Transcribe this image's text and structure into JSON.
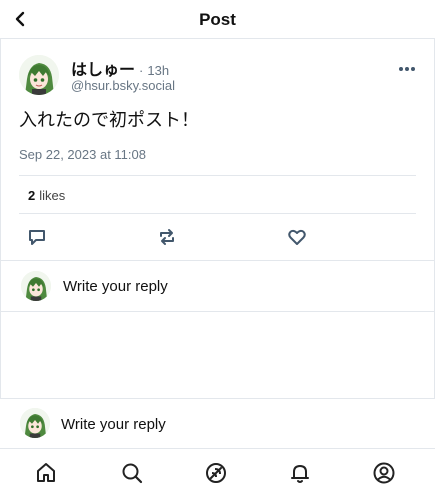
{
  "header": {
    "back_icon": "chevron-left-icon",
    "title": "Post"
  },
  "post": {
    "display_name": "はしゅー",
    "separator": "·",
    "time": "13h",
    "handle": "@hsur.bsky.social",
    "text": "入れたので初ポスト！",
    "date": "Sep 22, 2023 at 11:08",
    "likes_count": "2",
    "likes_label": "likes",
    "actions": [
      "reply-icon",
      "repost-icon",
      "like-heart-icon"
    ],
    "more_icon": "more-dots-icon"
  },
  "reply": {
    "placeholder": "Write your reply"
  },
  "bottom_reply": {
    "placeholder": "Write your reply"
  },
  "tabbar": {
    "items": [
      "home-icon",
      "search-icon",
      "feeds-icon",
      "notifications-bell-icon",
      "profile-icon"
    ]
  },
  "colors": {
    "text": "#111111",
    "muted": "#687684",
    "border": "#e3e7ec",
    "icon": "#42576c"
  }
}
